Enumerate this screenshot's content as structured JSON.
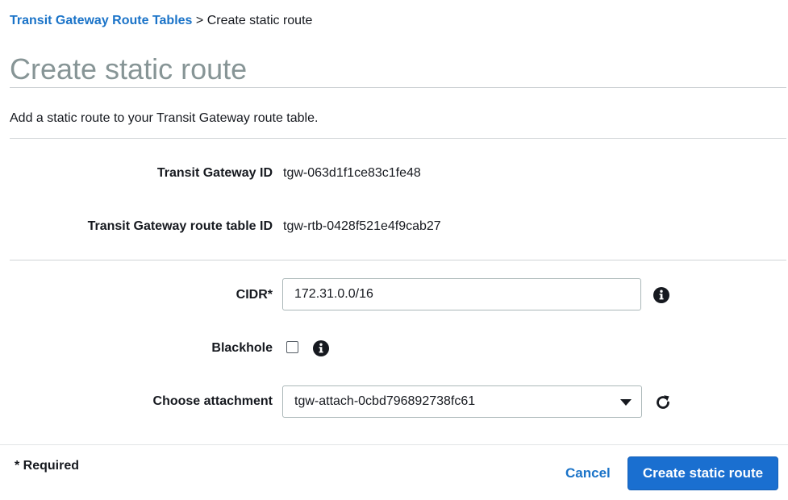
{
  "breadcrumb": {
    "parent": "Transit Gateway Route Tables",
    "separator": ">",
    "current": "Create static route"
  },
  "page": {
    "title": "Create static route",
    "description": "Add a static route to your Transit Gateway route table."
  },
  "details": {
    "tgw_id_label": "Transit Gateway ID",
    "tgw_id_value": "tgw-063d1f1ce83c1fe48",
    "route_table_label": "Transit Gateway route table ID",
    "route_table_value": "tgw-rtb-0428f521e4f9cab27"
  },
  "form": {
    "cidr_label": "CIDR*",
    "cidr_value": "172.31.0.0/16",
    "blackhole_label": "Blackhole",
    "blackhole_checked": false,
    "attachment_label": "Choose attachment",
    "attachment_value": "tgw-attach-0cbd796892738fc61"
  },
  "footer": {
    "required_note": "* Required",
    "cancel_label": "Cancel",
    "submit_label": "Create static route"
  },
  "icons": {
    "info": "info-icon",
    "refresh": "refresh-icon",
    "dropdown": "caret-down-icon"
  },
  "colors": {
    "link": "#1a73c8",
    "primary_button": "#1a6fd0",
    "title": "#879596",
    "border": "#aab7b8"
  }
}
